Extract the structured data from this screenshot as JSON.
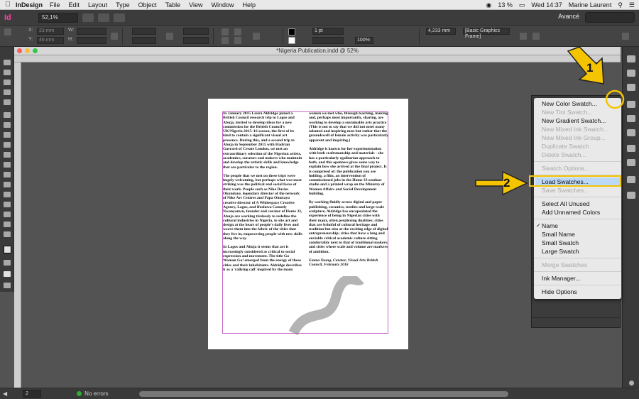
{
  "menubar": {
    "app": "InDesign",
    "items": [
      "File",
      "Edit",
      "Layout",
      "Type",
      "Object",
      "Table",
      "View",
      "Window",
      "Help"
    ],
    "battery": "13 %",
    "clock": "Wed 14:37",
    "user": "Marine Laurent"
  },
  "appbar": {
    "logo": "Id",
    "zoom": "52,1%",
    "workspace": "Avancé"
  },
  "control": {
    "x": "23 mm",
    "y": "46 mm",
    "x_label": "X:",
    "y_label": "Y:",
    "w_label": "W:",
    "h_label": "H:",
    "stroke": "1 pt",
    "opacity": "100%",
    "dimension": "4,233 mm",
    "frame_style": "[Basic Graphics Frame]"
  },
  "document": {
    "title": "*Nigeria Publication.indd @ 52%",
    "col1": [
      "In January 2015 Laura Aldridge joined a British Council research trip to Lagos and Abuja, invited to develop ideas for a new commission for the British Council's UK/Nigeria 2015–16 season, the first of its kind to contain a significant visual art presence. During this, and a second trip to Abuja in September 2015 with Hadrian Garrard of Create London, we met an extraordinary selection of the Nigerian artists, academics, curators and makers who maintain and develop the artistic skills and knowledge that are particular to the region.",
      "The people that we met on these trips were hugely welcoming, but perhaps what was most striking was the political and social focus of their work. People such as Nike Davies Okundaye, legendary director of the network of Nike Art Centres and Papa Omotayo creative director of A Whitespace Creative Agency, Lagos, and Ifeoluwa Comedy Nwanyanwu, founder and curator of Home 33, Abuja are working tirelessly to redefine the cultural industries in Nigeria, to site art and design at the heart of people's daily lives and weave them into the fabric of the cities that they live in, empowering people with new skills along the way.",
      "In Lagos and Abuja it seems that art is increasingly considered as critical to social expression and movement. The title Go Woman Go! emerged from the energy of these cities and their inhabitants. Aldridge describes it as a 'rallying call' inspired by the many"
    ],
    "col2": [
      "women we met who, through teaching, making and, perhaps most importantly, sharing, are working to develop a sustainable arts practice (This is not to say that we did not meet many talented and inspiring men but rather that the groundswell of female activity was particularly apparent and inspiring.)",
      "Aldridge is known for her experimentation with both craftsmanship and materials - she has a particularly egalitarian approach to both, and this openness gives some way to explain how she arrived at the final project. It is comprised of: the publication you are holding, a film, an intervention of commissioned jobs in the Home 33 outdoor studio and a printed wrap on the Ministry of Women Affairs and Social Development building.",
      "By working fluidly across digital and paper publishing, ceramics, textiles and large-scale sculpture, Aldridge has encapsulated the experience of being in Nigerian cities with their many, often perplexing dualities; cities that are brimful of cultural heritage and tradition but also at the exciting edge of digital entrepreneurship; cities that have a long and enviable critical academic culture sitting comfortably next to that of traditional makers; and cities where scale and volume are markers of ambition.",
      "Emma Young, Curator, Visual Arts British Council, February 2016"
    ]
  },
  "status": {
    "page": "2",
    "errors": "No errors"
  },
  "menu": {
    "new_color_swatch": "New Color Swatch...",
    "new_tint_swatch": "New Tint Swatch...",
    "new_gradient_swatch": "New Gradient Swatch...",
    "new_mixed_ink_swatch": "New Mixed Ink Swatch...",
    "new_mixed_ink_group": "New Mixed Ink Group...",
    "duplicate_swatch": "Duplicate Swatch",
    "delete_swatch": "Delete Swatch...",
    "swatch_options": "Swatch Options...",
    "load_swatches": "Load Swatches...",
    "save_swatches": "Save Swatches...",
    "select_all_unused": "Select All Unused",
    "add_unnamed_colors": "Add Unnamed Colors",
    "name": "Name",
    "small_name": "Small Name",
    "small_swatch": "Small Swatch",
    "large_swatch": "Large Swatch",
    "merge_swatches": "Merge Swatches",
    "ink_manager": "Ink Manager...",
    "hide_options": "Hide Options"
  },
  "annotations": {
    "step1": "1",
    "step2": "2",
    "arrow_color": "#f5c400"
  }
}
